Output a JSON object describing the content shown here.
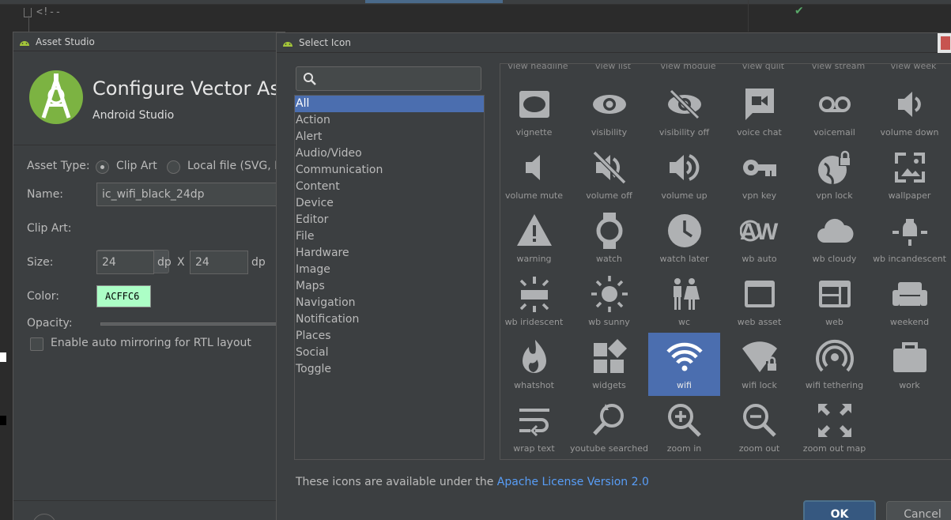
{
  "editor": {
    "code_snippet": "<!--"
  },
  "asset_studio": {
    "window_title": "Asset Studio",
    "heading": "Configure Vector Asset",
    "subheading": "Android Studio",
    "form": {
      "asset_type_label": "Asset Type:",
      "asset_type_options": [
        "Clip Art",
        "Local file (SVG, PSD)"
      ],
      "name_label": "Name:",
      "name_value": "ic_wifi_black_24dp",
      "clip_art_label": "Clip Art:",
      "size_label": "Size:",
      "size_width": "24",
      "size_height": "24",
      "size_unit": "dp",
      "size_separator": "X",
      "color_label": "Color:",
      "color_value": "ACFFC6",
      "opacity_label": "Opacity:",
      "auto_mirror_label": "Enable auto mirroring for RTL layout"
    }
  },
  "select_icon": {
    "window_title": "Select Icon",
    "search_placeholder": "",
    "categories": [
      "All",
      "Action",
      "Alert",
      "Audio/Video",
      "Communication",
      "Content",
      "Device",
      "Editor",
      "File",
      "Hardware",
      "Image",
      "Maps",
      "Navigation",
      "Notification",
      "Places",
      "Social",
      "Toggle"
    ],
    "selected_category": "All",
    "top_row_labels": [
      "view headline",
      "view list",
      "view module",
      "view quilt",
      "view stream",
      "view week"
    ],
    "icons": [
      "vignette",
      "visibility",
      "visibility off",
      "voice chat",
      "voicemail",
      "volume down",
      "volume mute",
      "volume off",
      "volume up",
      "vpn key",
      "vpn lock",
      "wallpaper",
      "warning",
      "watch",
      "watch later",
      "wb auto",
      "wb cloudy",
      "wb incandescent",
      "wb iridescent",
      "wb sunny",
      "wc",
      "web asset",
      "web",
      "weekend",
      "whatshot",
      "widgets",
      "wifi",
      "wifi lock",
      "wifi tethering",
      "work",
      "wrap text",
      "youtube searched for",
      "zoom in",
      "zoom out",
      "zoom out map"
    ],
    "selected_icon": "wifi",
    "license_prefix": "These icons are available under the ",
    "license_link": "Apache License Version 2.0",
    "ok_label": "OK",
    "cancel_label": "Cancel"
  },
  "colors": {
    "accent": "#4b6eaf",
    "swatch": "#acffc6",
    "link": "#589df6",
    "icon": "#afb1b3"
  }
}
